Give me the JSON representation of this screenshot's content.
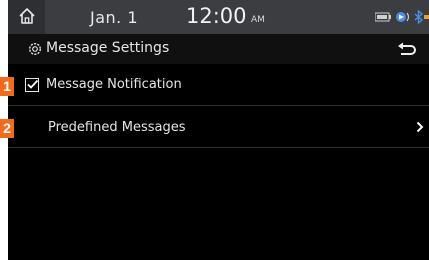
{
  "status_bar": {
    "date": "Jan.  1",
    "time": "12:00",
    "ampm": "AM",
    "icons": [
      "battery-icon",
      "media-icon",
      "bluetooth-icon"
    ]
  },
  "header": {
    "icon": "gear-icon",
    "title": "Message Settings",
    "back_icon": "back-arrow-icon"
  },
  "items": [
    {
      "label": "Message Notification",
      "checked": true
    },
    {
      "label": "Predefined Messages",
      "icon": "chevron-right-icon"
    }
  ],
  "callouts": [
    "1",
    "2"
  ],
  "colors": {
    "callout": "#f26b1d",
    "status_bar": "#3b3d41",
    "background": "#000000",
    "text": "#e5e5e5"
  }
}
